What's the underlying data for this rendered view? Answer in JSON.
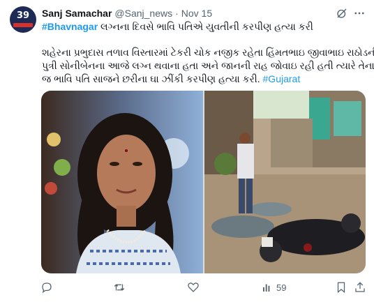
{
  "author": {
    "display_name": "Sanj Samachar",
    "handle": "@Sanj_news",
    "separator": "·",
    "time": "Nov 15",
    "avatar_number": "39"
  },
  "tweet": {
    "hashtag_main": "#Bhavnagar",
    "title": " લગ્નના દિવસે ભાવિ પતિએ યુવતીની કરપીણ હત્યા કરી",
    "body_lines": [
      "શહેરના પ્રભુદાસ તળાવ વિસ્તારમાં ટેકરી ચોક નજીક રહેતા હિંમતભાઇ જીવાભાઇ રાઠોડની",
      "પુત્રી સોનીબેનના આજે લગ્ન થવાના હતા અને જાનની  રાહ જોવાઇ રહી હતી ત્યારે તેના ઘરે",
      "જ ભાવિ પતિ સાજને છરીના ઘા ઝીંકી કરપીણ હત્યા કરી. "
    ],
    "body_tag": "#Gujarat"
  },
  "actions": {
    "views": "59"
  },
  "icons": [
    "grok-icon",
    "more-icon",
    "reply-icon",
    "retweet-icon",
    "like-icon",
    "views-icon",
    "bookmark-icon",
    "share-icon"
  ],
  "colors": {
    "link": "#1d9bf0",
    "secondary_text": "#536471",
    "primary_text": "#0f1419"
  }
}
